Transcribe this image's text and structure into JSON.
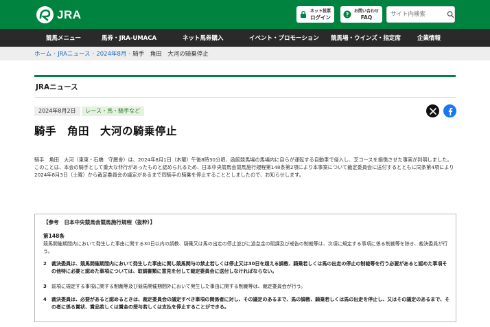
{
  "header": {
    "logo_text": "JRA",
    "login_button": {
      "line1": "ネット投票",
      "line2": "ログイン",
      "icon": "lock-icon"
    },
    "faq_button": {
      "line1": "お問い合わせ",
      "line2": "FAQ",
      "icon": "question-icon"
    },
    "search": {
      "placeholder": "サイト内検索",
      "icon": "search-icon"
    }
  },
  "nav": {
    "items": [
      {
        "label": "競馬メニュー"
      },
      {
        "label": "馬券・JRA-UMACA"
      },
      {
        "label": "ネット馬券購入"
      },
      {
        "label": "イベント・プロモーション"
      },
      {
        "label": "競馬場・ウインズ・指定席"
      },
      {
        "label": "企業情報"
      }
    ]
  },
  "breadcrumb": {
    "items": [
      {
        "label": "ホーム"
      },
      {
        "label": "JRAニュース"
      },
      {
        "label": "2024年8月"
      }
    ],
    "current": "騎手　角田　大河の騎乗停止"
  },
  "section": {
    "title": "JRAニュース"
  },
  "article": {
    "date": "2024年8月2日",
    "category": "レース・馬・騎手など",
    "title": "騎手　角田　大河の騎乗停止",
    "paragraphs": [
      "騎手　角田　大河（東東・石橋　守厩舎）は、2024年8月1日（木曜）午後8時30分頃、函館競馬場の馬場内に自らが運転する自動車で侵入し、芝コースを損傷させた事実が判明しました。",
      "このことは、本会の騎手として重大な非行があったものと認められるため、日本中央競馬会競馬施行規程第148条第2項により本事案について裁定委員会に送付するとともに同条第4項により2024年8月3日（土曜）から裁定委員会の議定があるまで同騎手の騎乗を停止することとしましたので、お知らせします。"
    ],
    "social": {
      "x_icon": "x-icon",
      "facebook_icon": "facebook-icon"
    }
  },
  "reference": {
    "heading": "【参考　日本中央競馬会競馬施行規程（抜粋）】",
    "article_no": "第148条",
    "intro": "競馬開催期間内において発生した事由に関する30日以内の調教、騎乗又は馬の出走の停止並びに過怠金の賦課及び戒告の制裁等は、次項に規定する事項に係る制裁等を除き、裁決委員が行う。",
    "items": [
      {
        "num": "2",
        "text": "裁決委員は、競馬開催期間内において発生した事由に関し競馬関与の禁止若しくは停止又は30日を超える調教、騎乗若しくは馬の出走の停止の制裁等を行う必要があると認めた事項その他特に必要と認めた事項については、取調書類に意見を付して裁定委員会に送付しなければならない。"
      },
      {
        "num": "3",
        "text": "前項に規定する事項に関する制裁等及び競馬開催期間外において発生した事由に関する制裁等は、裁定委員会が行う。"
      },
      {
        "num": "4",
        "text": "裁決委員は、必要があると認めるときは、裁定委員会の議定すべき事項の関係者に対し、その議定のあるまで、馬の調教、騎乗若しくは馬の出走を停止し、又はその議定のあるまで、その者に係る賞状、賞品若しくは賞金の授与若しくは支払を停止することができる。"
      }
    ]
  },
  "colors": {
    "brand_green": "#00833f",
    "nav_dark": "#2a2a2a",
    "link_blue": "#1f6ab8",
    "facebook_blue": "#1877f2"
  }
}
